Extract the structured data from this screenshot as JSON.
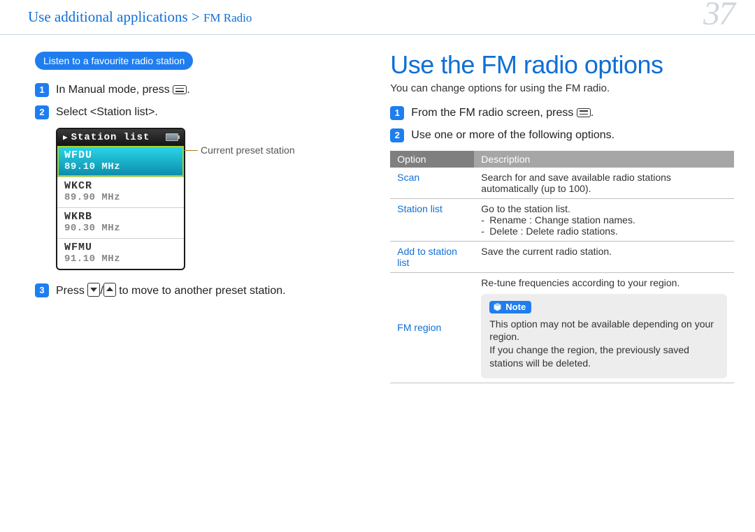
{
  "header": {
    "breadcrumb_main": "Use additional applications",
    "breadcrumb_sep": " > ",
    "breadcrumb_sub": "FM Radio",
    "page_number": "37"
  },
  "left": {
    "pill": "Listen to a favourite radio station",
    "step1_pre": "In Manual mode, press ",
    "step1_post": ".",
    "step2": "Select <Station list>.",
    "step3_pre": "Press ",
    "step3_mid": "/",
    "step3_post": " to move to another preset station.",
    "callout": "Current preset station",
    "screenshot": {
      "title": "Station list",
      "items": [
        {
          "call": "WFDU",
          "freq": "89.10 MHz",
          "active": true
        },
        {
          "call": "WKCR",
          "freq": "89.90 MHz",
          "active": false
        },
        {
          "call": "WKRB",
          "freq": "90.30 MHz",
          "active": false
        },
        {
          "call": "WFMU",
          "freq": "91.10 MHz",
          "active": false
        }
      ]
    }
  },
  "right": {
    "title": "Use the FM radio options",
    "subtitle": "You can change options for using the FM radio.",
    "step1_pre": "From the FM radio screen, press ",
    "step1_post": ".",
    "step2": "Use one or more of the following options.",
    "table": {
      "h_option": "Option",
      "h_desc": "Description",
      "rows": {
        "scan": {
          "opt": "Scan",
          "desc": "Search for and save available radio stations automatically (up to 100)."
        },
        "station_list": {
          "opt": "Station list",
          "line1": "Go to the station list.",
          "li1": "Rename : Change station names.",
          "li2": "Delete : Delete radio stations."
        },
        "add": {
          "opt": "Add to station list",
          "desc": "Save the current radio station."
        },
        "fm_region": {
          "opt": "FM region",
          "intro": "Re-tune frequencies according to your region.",
          "note_label": "Note",
          "note_text": "This option may not be available depending on your region.\nIf you change the region, the previously saved stations will be deleted."
        }
      }
    }
  }
}
